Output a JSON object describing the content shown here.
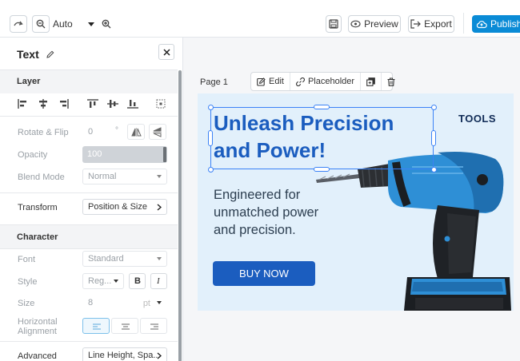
{
  "toolbar": {
    "zoom_value": "Auto",
    "preview_label": "Preview",
    "export_label": "Export",
    "publish_label": "Publish",
    "icons": [
      "redo-icon",
      "zoom-out-icon",
      "chevron-down-icon",
      "zoom-in-icon",
      "save-icon",
      "eye-icon",
      "export-icon",
      "cloud-icon"
    ]
  },
  "panel": {
    "title": "Text",
    "layer_heading": "Layer",
    "rotate_label": "Rotate & Flip",
    "rotate_value": "0",
    "rotate_unit": "°",
    "opacity_label": "Opacity",
    "opacity_value": "100",
    "blend_label": "Blend Mode",
    "blend_value": "Normal",
    "transform_label": "Transform",
    "transform_value": "Position & Size",
    "character_heading": "Character",
    "font_label": "Font",
    "font_value": "Standard",
    "style_label": "Style",
    "style_value": "Reg...",
    "bold_label": "B",
    "italic_label": "I",
    "size_label": "Size",
    "size_value": "8",
    "size_unit": "pt",
    "halign_label": "Horizontal Alignment",
    "advanced_label": "Advanced",
    "advanced_value": "Line Height, Spa..."
  },
  "canvas": {
    "page_label": "Page 1",
    "edit_label": "Edit",
    "placeholder_label": "Placeholder",
    "headline_line1": "Unleash Precision",
    "headline_line2": "and Power!",
    "sub_line1": "Engineered for",
    "sub_line2": "unmatched power",
    "sub_line3": "and precision.",
    "button_label": "BUY NOW",
    "logo_text": "TOOLS"
  },
  "colors": {
    "accent": "#0a8bd6",
    "headline": "#1b5dbf",
    "artboard_bg": "#e2f0fb",
    "selection": "#3b82f6"
  }
}
